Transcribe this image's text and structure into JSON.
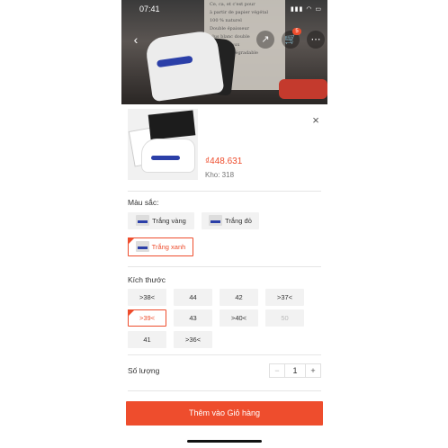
{
  "status_bar": {
    "time": "07:41",
    "right": "▮▮▮ ◠ ▭"
  },
  "photo_text": [
    "Ce, ca, et c'est pour",
    "à partir de papier végétal",
    "100 % naturel",
    "Double épaisseur",
    "plus blanc double",
    "Convient aux",
    "100 % biodégradable"
  ],
  "header": {
    "back_icon": "‹",
    "share_icon": "↗",
    "cart_icon": "🛒",
    "cart_badge": "5",
    "more_icon": "⋯"
  },
  "product": {
    "price": "₫448.631",
    "stock": "Kho: 318",
    "close_icon": "×"
  },
  "color_section": {
    "label": "Màu sắc:",
    "options": [
      {
        "label": "Trắng vàng",
        "selected": false
      },
      {
        "label": "Trắng đỏ",
        "selected": false
      },
      {
        "label": "Trắng xanh",
        "selected": true
      }
    ]
  },
  "size_section": {
    "label": "Kích thước",
    "options": [
      {
        "label": ">38<",
        "selected": false,
        "disabled": false
      },
      {
        "label": "44",
        "selected": false,
        "disabled": false
      },
      {
        "label": "42",
        "selected": false,
        "disabled": false
      },
      {
        "label": ">37<",
        "selected": false,
        "disabled": false
      },
      {
        "label": ">39<",
        "selected": true,
        "disabled": false
      },
      {
        "label": "43",
        "selected": false,
        "disabled": false
      },
      {
        "label": ">40<",
        "selected": false,
        "disabled": false
      },
      {
        "label": "50",
        "selected": false,
        "disabled": true
      },
      {
        "label": "41",
        "selected": false,
        "disabled": false
      },
      {
        "label": ">36<",
        "selected": false,
        "disabled": false
      }
    ]
  },
  "quantity": {
    "label": "Số lượng",
    "minus": "−",
    "value": "1",
    "plus": "+"
  },
  "add_to_cart": {
    "label": "Thêm vào Giỏ hàng"
  },
  "colors": {
    "accent": "#ee4d2d"
  }
}
